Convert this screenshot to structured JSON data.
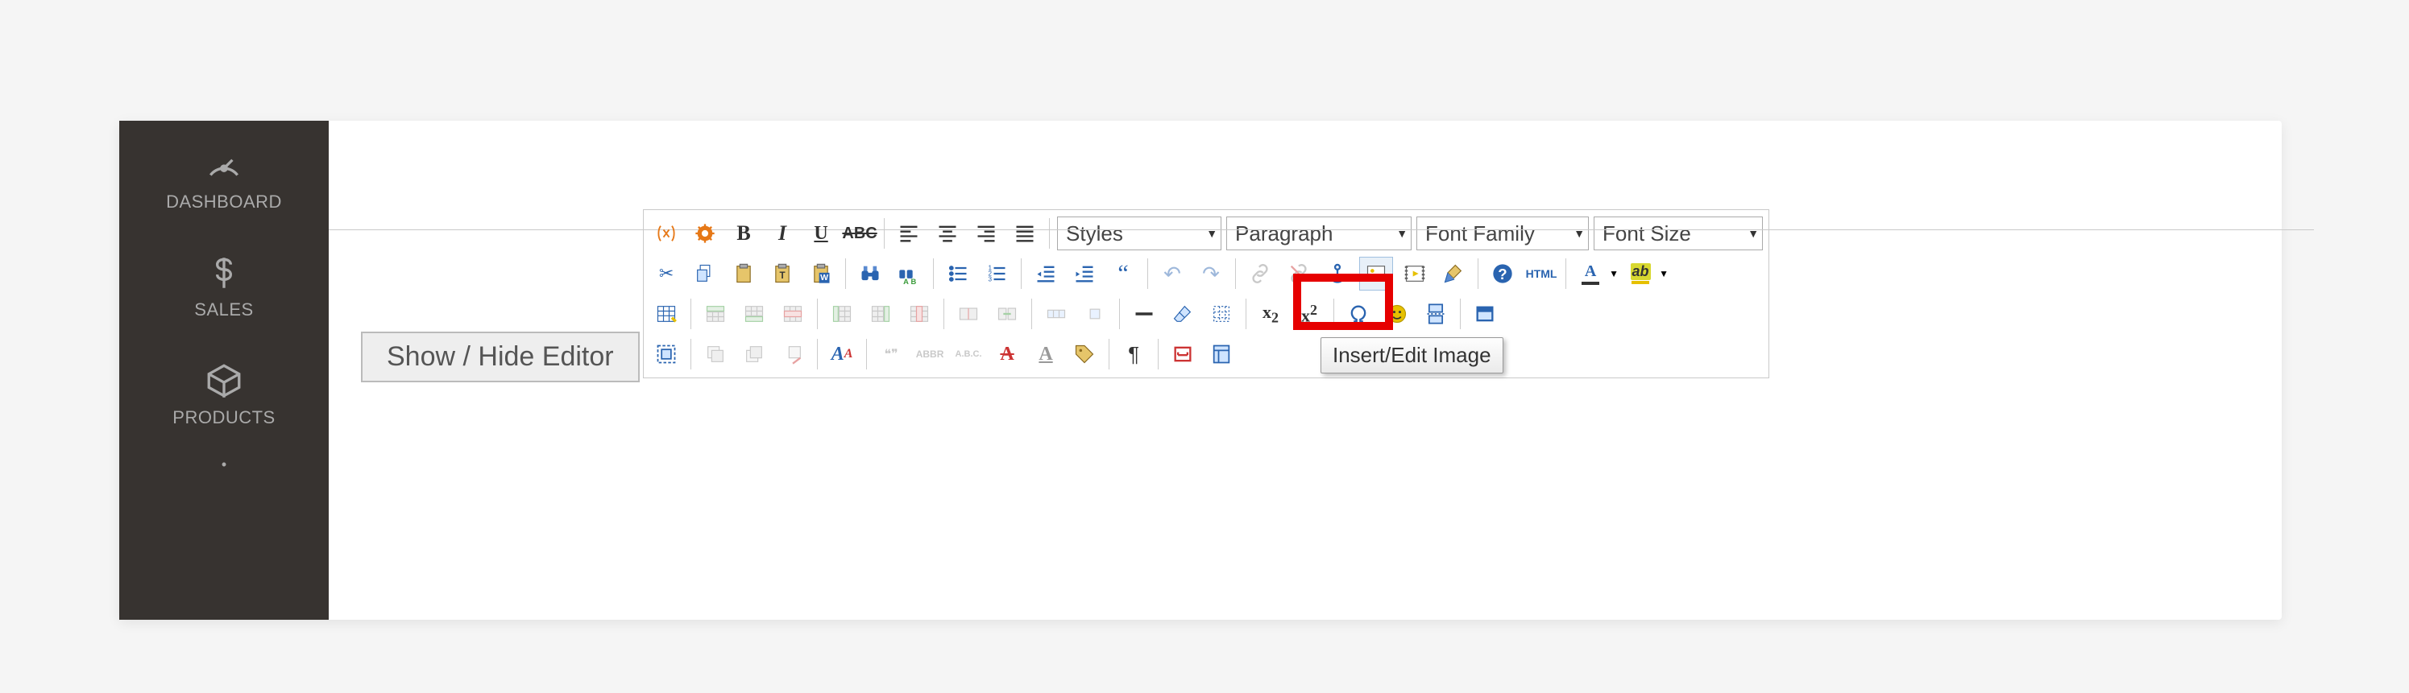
{
  "sidebar": {
    "items": [
      {
        "label": "DASHBOARD"
      },
      {
        "label": "SALES"
      },
      {
        "label": "PRODUCTS"
      }
    ]
  },
  "main": {
    "toggle_label": "Show / Hide Editor",
    "selects": {
      "styles": "Styles",
      "format": "Paragraph",
      "fontfamily": "Font Family",
      "fontsize": "Font Size"
    }
  },
  "tooltip": {
    "text": "Insert/Edit Image"
  },
  "toolbar": {
    "row1": [
      "variable",
      "widget",
      "bold",
      "italic",
      "underline",
      "strikethrough",
      "sep",
      "align-left",
      "align-center",
      "align-right",
      "align-justify",
      "sep",
      "styles-select",
      "format-select",
      "fontfamily-select",
      "fontsize-select"
    ],
    "row2": [
      "cut",
      "copy",
      "paste",
      "paste-text",
      "paste-word",
      "sep",
      "find",
      "replace",
      "sep",
      "unordered-list",
      "ordered-list",
      "sep",
      "outdent",
      "indent",
      "blockquote",
      "sep",
      "undo",
      "redo",
      "sep",
      "link",
      "unlink",
      "anchor",
      "insert-image",
      "media",
      "cleanup",
      "sep",
      "help",
      "html-source",
      "sep",
      "text-color",
      "dd",
      "background-color",
      "dd"
    ],
    "row3": [
      "table",
      "sep",
      "row-before",
      "row-after",
      "delete-row",
      "sep",
      "col-before",
      "col-after",
      "delete-col",
      "sep",
      "split-merged",
      "merge-cells",
      "sep",
      "row-props",
      "cell-props",
      "sep",
      "hr",
      "remove-format",
      "show-blocks",
      "sep",
      "subscript",
      "superscript",
      "sep",
      "select-color",
      "layers",
      "select-all",
      "sep",
      "fullscreen"
    ],
    "row4": [
      "spellcheck",
      "sep",
      "layer-abs",
      "layer-fwd",
      "layer-back",
      "sep",
      "style-props",
      "sep",
      "cite",
      "abbr",
      "acronym",
      "del",
      "ins",
      "attribs",
      "sep",
      "ltr",
      "sep",
      "nbsp",
      "template"
    ]
  },
  "glyphs": {
    "html_text": "HTML",
    "abc_text": "ABC",
    "abbr_text": "ABBR",
    "acronym_text": "A.B.C.",
    "bold_b": "B",
    "ital_i": "I",
    "under_u": "U",
    "strike_abc": "ABC",
    "quote66": "“",
    "sub_x": "x",
    "sub_2": "2",
    "sup_x": "x",
    "sup_2": "2",
    "underline_A": "A",
    "highlight_ab": "ab",
    "del_A": "A",
    "ins_A": "A",
    "Aa": "A",
    "pilcrow": "¶",
    "scissors": "✂",
    "search": "🔍",
    "undo": "↶",
    "redo": "↷",
    "link": "🔗",
    "help": "?",
    "cite_6699": "❝❞"
  },
  "colors": {
    "highlight_box": "#e60000",
    "sidebar_bg": "#373330"
  }
}
